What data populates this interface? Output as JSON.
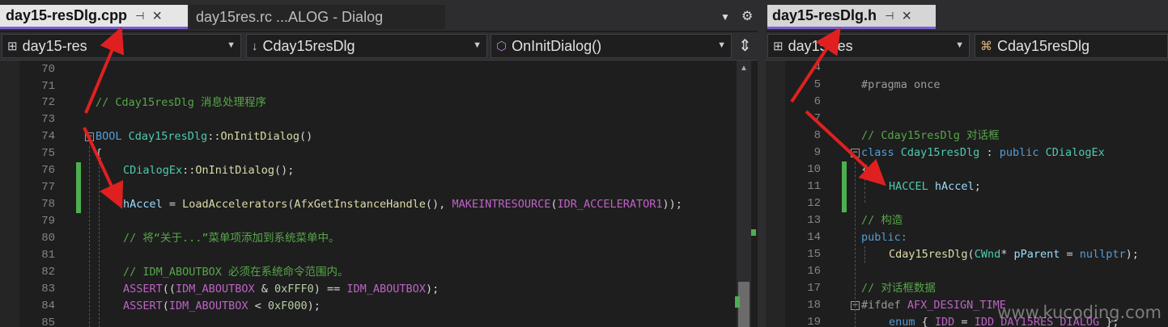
{
  "left_pane": {
    "tabs": [
      {
        "label": "day15-resDlg.cpp",
        "active": true
      },
      {
        "label": "day15res.rc ...ALOG - Dialog",
        "active": false
      }
    ],
    "nav": {
      "project": "day15-res",
      "class": "Cday15resDlg",
      "member": "OnInitDialog()"
    }
  },
  "right_pane": {
    "tab": {
      "label": "day15-resDlg.h",
      "active": true
    },
    "nav": {
      "project": "day15-res",
      "class": "Cday15resDlg"
    }
  },
  "watermark": "www.kucoding.com",
  "colors": {
    "active_tab_accent": "#7b5fd6",
    "change_bar": "#4caf50",
    "annotation_arrow": "#e02020"
  },
  "icons": [
    "pin-icon",
    "close-icon",
    "dropdown-icon",
    "gear-icon",
    "class-icon",
    "method-icon",
    "split-icon",
    "project-icon"
  ]
}
